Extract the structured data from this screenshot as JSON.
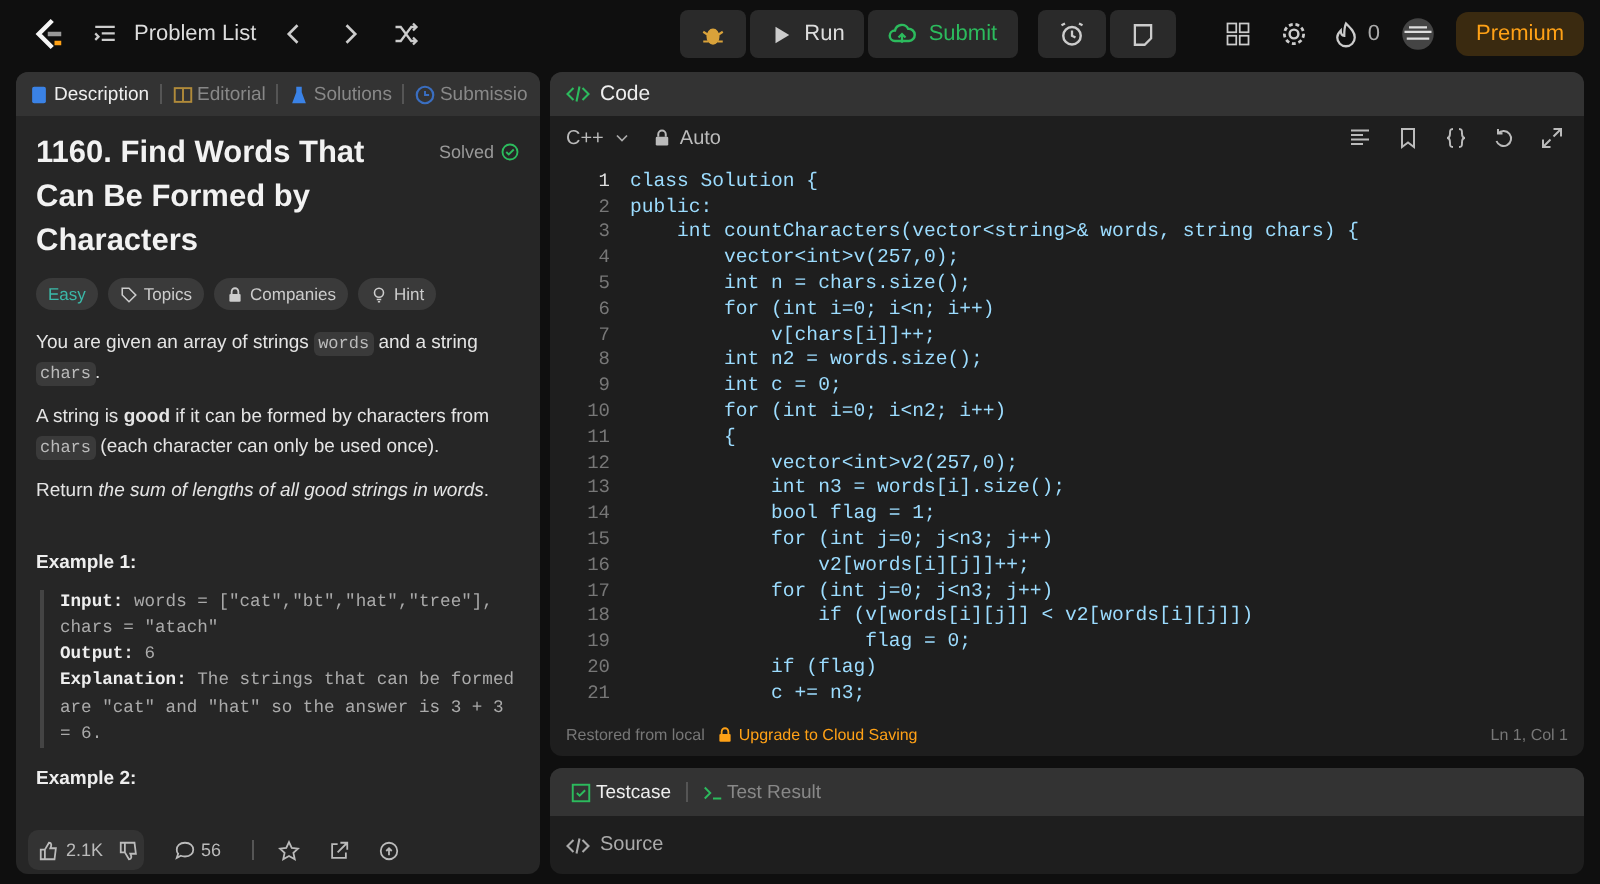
{
  "topbar": {
    "nav_label": "Problem List",
    "run_label": "Run",
    "submit_label": "Submit",
    "streak": "0",
    "premium_label": "Premium"
  },
  "left_tabs": [
    {
      "label": "Description",
      "selected": true,
      "kind": "doc"
    },
    {
      "label": "Editorial",
      "selected": false,
      "kind": "book"
    },
    {
      "label": "Solutions",
      "selected": false,
      "kind": "flask"
    },
    {
      "label": "Submissio",
      "selected": false,
      "kind": "clock"
    }
  ],
  "problem": {
    "title": "1160. Find Words That Can Be Formed by Characters",
    "status": "Solved",
    "tags": [
      {
        "label": "Easy",
        "kind": "difficulty"
      },
      {
        "label": "Topics",
        "kind": "tag"
      },
      {
        "label": "Companies",
        "kind": "lock"
      },
      {
        "label": "Hint",
        "kind": "bulb"
      }
    ],
    "paragraphs": [
      [
        {
          "kind": "text",
          "text": "You are given an array of strings "
        },
        {
          "kind": "code",
          "text": "words"
        },
        {
          "kind": "text",
          "text": " and a string "
        },
        {
          "kind": "code",
          "text": "chars"
        },
        {
          "kind": "text",
          "text": "."
        }
      ],
      [
        {
          "kind": "text",
          "text": "A string is **good** if it can be formed by characters from "
        },
        {
          "kind": "code",
          "text": "chars"
        },
        {
          "kind": "text",
          "text": " (each character can only be used once)."
        }
      ],
      [
        {
          "kind": "text",
          "text": "Return *the sum of lengths of all good strings in words*."
        }
      ]
    ],
    "examples": [
      {
        "heading": "Example 1:",
        "lines": [
          "**Input:** words = [\"cat\",\"bt\",\"hat\",\"tree\"], chars = \"atach\"",
          "**Output:** 6",
          "**Explanation:** The strings that can be formed are \"cat\" and \"hat\" so the answer is 3 + 3 = 6."
        ]
      },
      {
        "heading": "Example 2:"
      }
    ],
    "likes": "2.1K",
    "comments": "56"
  },
  "code_panel": {
    "title": "Code",
    "language": "C++",
    "mode": "Auto",
    "lines": [
      {
        "n": "1",
        "text": "class Solution {",
        "current": true
      },
      {
        "n": "2",
        "text": "public:",
        "current": false
      },
      {
        "n": "3",
        "text": "    int countCharacters(vector<string>& words, string chars) {",
        "current": false
      },
      {
        "n": "4",
        "text": "        vector<int>v(257,0);",
        "current": false
      },
      {
        "n": "5",
        "text": "        int n = chars.size();",
        "current": false
      },
      {
        "n": "6",
        "text": "        for (int i=0; i<n; i++)",
        "current": false
      },
      {
        "n": "7",
        "text": "            v[chars[i]]++;",
        "current": false
      },
      {
        "n": "8",
        "text": "        int n2 = words.size();",
        "current": false
      },
      {
        "n": "9",
        "text": "        int c = 0;",
        "current": false
      },
      {
        "n": "10",
        "text": "        for (int i=0; i<n2; i++)",
        "current": false
      },
      {
        "n": "11",
        "text": "        {",
        "current": false
      },
      {
        "n": "12",
        "text": "            vector<int>v2(257,0);",
        "current": false
      },
      {
        "n": "13",
        "text": "            int n3 = words[i].size();",
        "current": false
      },
      {
        "n": "14",
        "text": "            bool flag = 1;",
        "current": false
      },
      {
        "n": "15",
        "text": "            for (int j=0; j<n3; j++)",
        "current": false
      },
      {
        "n": "16",
        "text": "                v2[words[i][j]]++;",
        "current": false
      },
      {
        "n": "17",
        "text": "            for (int j=0; j<n3; j++)",
        "current": false
      },
      {
        "n": "18",
        "text": "                if (v[words[i][j]] < v2[words[i][j]])",
        "current": false
      },
      {
        "n": "19",
        "text": "                    flag = 0;",
        "current": false
      },
      {
        "n": "20",
        "text": "            if (flag)",
        "current": false
      },
      {
        "n": "21",
        "text": "            c += n3;",
        "current": false
      }
    ],
    "status_left": "Restored from local",
    "upgrade": "Upgrade to Cloud Saving",
    "cursor": "Ln 1, Col 1"
  },
  "test_panel": {
    "tabs": [
      {
        "label": "Testcase",
        "selected": true,
        "kind": "check"
      },
      {
        "label": "Test Result",
        "selected": false,
        "kind": "terminal"
      }
    ],
    "source_label": "Source"
  }
}
